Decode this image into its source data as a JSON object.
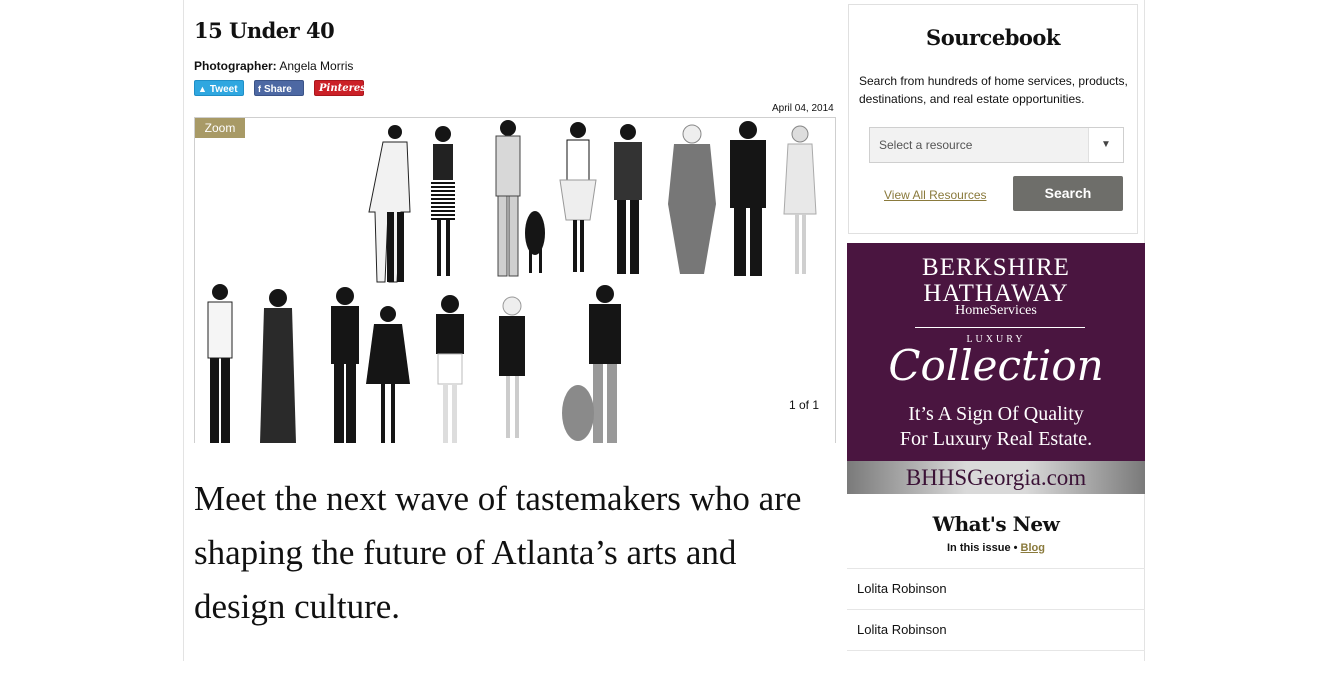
{
  "article": {
    "title": "15 Under 40",
    "photographer_label": "Photographer:",
    "photographer_name": "Angela Morris",
    "share": {
      "tweet": "Tweet",
      "share": "Share",
      "pinterest": "Pinterest"
    },
    "date": "April 04, 2014",
    "zoom_label": "Zoom",
    "counter": "1 of 1",
    "lede": "Meet the next wave of tastemakers who are shaping the future of Atlanta’s arts and design culture."
  },
  "sourcebook": {
    "title": "Sourcebook",
    "description": "Search from hundreds of home services, products, destinations, and real estate opportunities.",
    "select_value": "Select a resource",
    "view_all": "View All Resources",
    "search": "Search"
  },
  "ad": {
    "line1a": "BERKSHIRE",
    "line1b": "HATHAWAY",
    "line2": "HomeServices",
    "luxury": "LUXURY",
    "collection": "Collection",
    "tag1": "It’s A Sign Of Quality",
    "tag2": "For Luxury Real Estate.",
    "url": "BHHSGeorgia.com"
  },
  "whats_new": {
    "title": "What's New",
    "in_issue": "In this issue",
    "separator": "•",
    "blog": "Blog",
    "items": [
      "Lolita Robinson",
      "Lolita Robinson"
    ]
  }
}
